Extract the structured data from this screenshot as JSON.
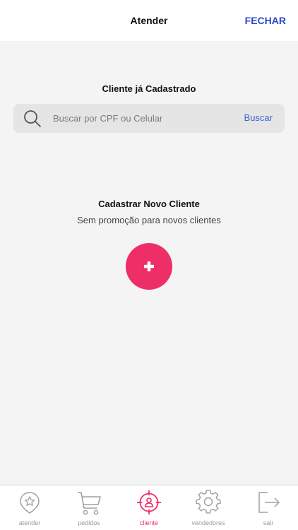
{
  "header": {
    "title": "Atender",
    "close_label": "FECHAR"
  },
  "existing_client": {
    "title": "Cliente já Cadastrado",
    "search_placeholder": "Buscar por CPF ou Celular",
    "search_button": "Buscar"
  },
  "new_client": {
    "title": "Cadastrar Novo Cliente",
    "subtitle": "Sem promoção para novos clientes",
    "add_icon": "plus-icon"
  },
  "tabbar": {
    "items": [
      {
        "label": "atender",
        "icon": "star-pin-icon",
        "active": false
      },
      {
        "label": "pedidos",
        "icon": "cart-icon",
        "active": false
      },
      {
        "label": "cliente",
        "icon": "client-target-icon",
        "active": true
      },
      {
        "label": "vendedores",
        "icon": "gear-icon",
        "active": false
      },
      {
        "label": "sair",
        "icon": "exit-icon",
        "active": false
      }
    ]
  },
  "colors": {
    "accent": "#ee2f67",
    "link": "#2b47c8",
    "background": "#f4f4f4",
    "inactive": "#9a9a9a"
  }
}
